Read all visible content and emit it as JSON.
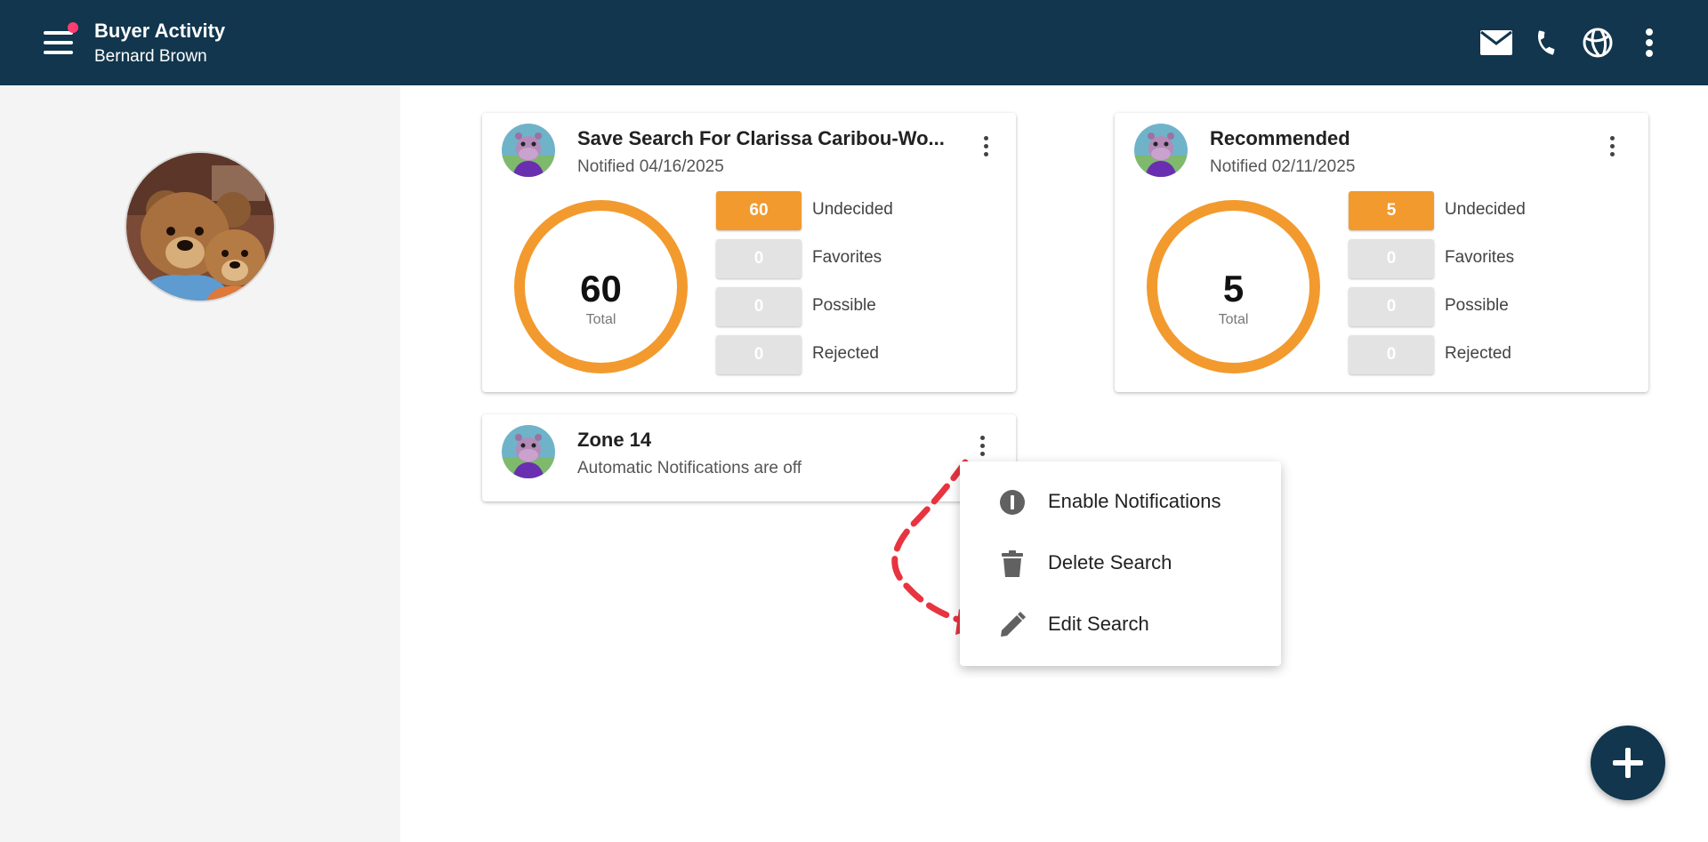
{
  "header": {
    "title": "Buyer Activity",
    "subtitle": "Bernard Brown",
    "icons": [
      "menu-icon",
      "mail-icon",
      "phone-icon",
      "globe-icon",
      "more-vert-icon"
    ],
    "notification_dot_color": "#ff3d71",
    "background_color": "#11364d"
  },
  "cards": [
    {
      "title": "Save Search For Clarissa Caribou-Wo...",
      "subtitle": "Notified 04/16/2025",
      "total": "60",
      "total_label": "Total",
      "stats": [
        {
          "value": "60",
          "label": "Undecided"
        },
        {
          "value": "0",
          "label": "Favorites"
        },
        {
          "value": "0",
          "label": "Possible"
        },
        {
          "value": "0",
          "label": "Rejected"
        }
      ]
    },
    {
      "title": "Recommended",
      "subtitle": "Notified 02/11/2025",
      "total": "5",
      "total_label": "Total",
      "stats": [
        {
          "value": "5",
          "label": "Undecided"
        },
        {
          "value": "0",
          "label": "Favorites"
        },
        {
          "value": "0",
          "label": "Possible"
        },
        {
          "value": "0",
          "label": "Rejected"
        }
      ]
    },
    {
      "title": "Zone 14",
      "subtitle": "Automatic Notifications are off"
    }
  ],
  "context_menu": {
    "items": [
      {
        "label": "Enable Notifications",
        "icon": "info-circle-icon"
      },
      {
        "label": "Delete Search",
        "icon": "trash-icon"
      },
      {
        "label": "Edit Search",
        "icon": "pencil-icon"
      }
    ]
  },
  "colors": {
    "accent_orange": "#f29a2e",
    "inactive_gray": "#e3e3e3",
    "annotation_red": "#e8343f"
  },
  "fab": {
    "icon": "plus-icon"
  }
}
